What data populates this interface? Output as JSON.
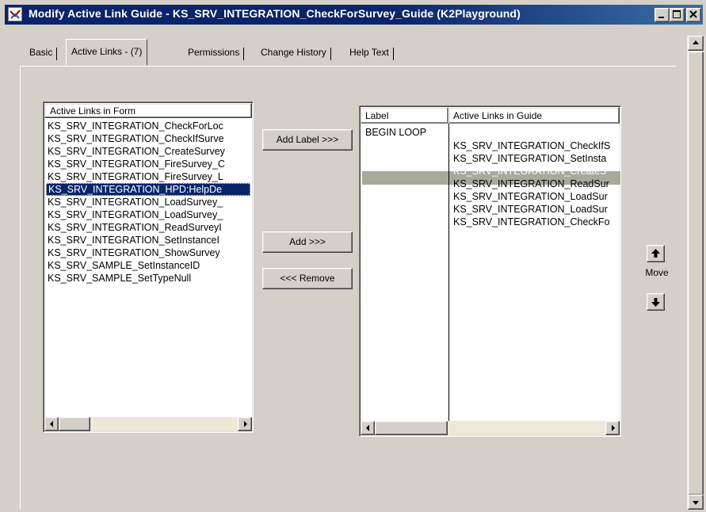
{
  "window": {
    "title": "Modify Active Link Guide - KS_SRV_INTEGRATION_CheckForSurvey_Guide (K2Playground)",
    "minimize": "_",
    "maximize": "□",
    "close": "×"
  },
  "tabs": [
    {
      "label": "Basic"
    },
    {
      "label": "Active Links - (7)"
    },
    {
      "label": "Permissions"
    },
    {
      "label": "Change History"
    },
    {
      "label": "Help Text"
    }
  ],
  "form_list": {
    "header": "Active Links in Form",
    "items": [
      "KS_SRV_INTEGRATION_CheckForLoc",
      "KS_SRV_INTEGRATION_CheckIfSurve",
      "KS_SRV_INTEGRATION_CreateSurvey",
      "KS_SRV_INTEGRATION_FireSurvey_C",
      "KS_SRV_INTEGRATION_FireSurvey_L",
      "KS_SRV_INTEGRATION_HPD:HelpDe",
      "KS_SRV_INTEGRATION_LoadSurvey_",
      "KS_SRV_INTEGRATION_LoadSurvey_",
      "KS_SRV_INTEGRATION_ReadSurveyI",
      "KS_SRV_INTEGRATION_SetInstanceI",
      "KS_SRV_INTEGRATION_ShowSurvey",
      "KS_SRV_SAMPLE_SetInstanceID",
      "KS_SRV_SAMPLE_SetTypeNull"
    ],
    "selected_index": 5
  },
  "buttons": {
    "add_label": "Add Label >>>",
    "add": "Add >>>",
    "remove": "<<< Remove"
  },
  "guide_list": {
    "label_header": "Label",
    "links_header": "Active Links in Guide",
    "labels": [
      "BEGIN LOOP"
    ],
    "items": [
      "KS_SRV_INTEGRATION_CheckIfS",
      "KS_SRV_INTEGRATION_SetInsta",
      "KS_SRV_INTEGRATION_CreateS",
      "KS_SRV_INTEGRATION_ReadSur",
      "KS_SRV_INTEGRATION_LoadSur",
      "KS_SRV_INTEGRATION_LoadSur",
      "KS_SRV_INTEGRATION_CheckFo"
    ],
    "selected_index": 2
  },
  "move": {
    "label": "Move"
  }
}
